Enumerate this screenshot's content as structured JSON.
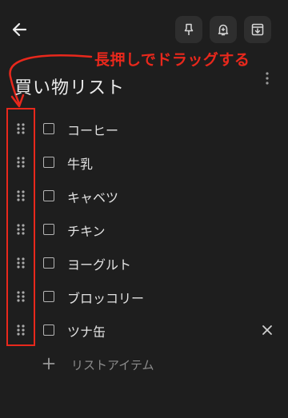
{
  "header": {
    "back_icon": "arrow-left-icon",
    "actions": [
      {
        "icon": "pin-icon"
      },
      {
        "icon": "reminder-bell-icon"
      },
      {
        "icon": "archive-icon"
      }
    ]
  },
  "annotation": {
    "text": "長押しでドラッグする",
    "color": "#e8281c"
  },
  "note": {
    "title": "買い物リスト",
    "more_icon": "more-vert-icon"
  },
  "checklist": {
    "items": [
      {
        "label": "コーヒー",
        "checked": false
      },
      {
        "label": "牛乳",
        "checked": false
      },
      {
        "label": "キャベツ",
        "checked": false
      },
      {
        "label": "チキン",
        "checked": false
      },
      {
        "label": "ヨーグルト",
        "checked": false
      },
      {
        "label": "ブロッコリー",
        "checked": false
      },
      {
        "label": "ツナ缶",
        "checked": false,
        "focused": true
      }
    ],
    "add_item_label": "リストアイテム"
  }
}
